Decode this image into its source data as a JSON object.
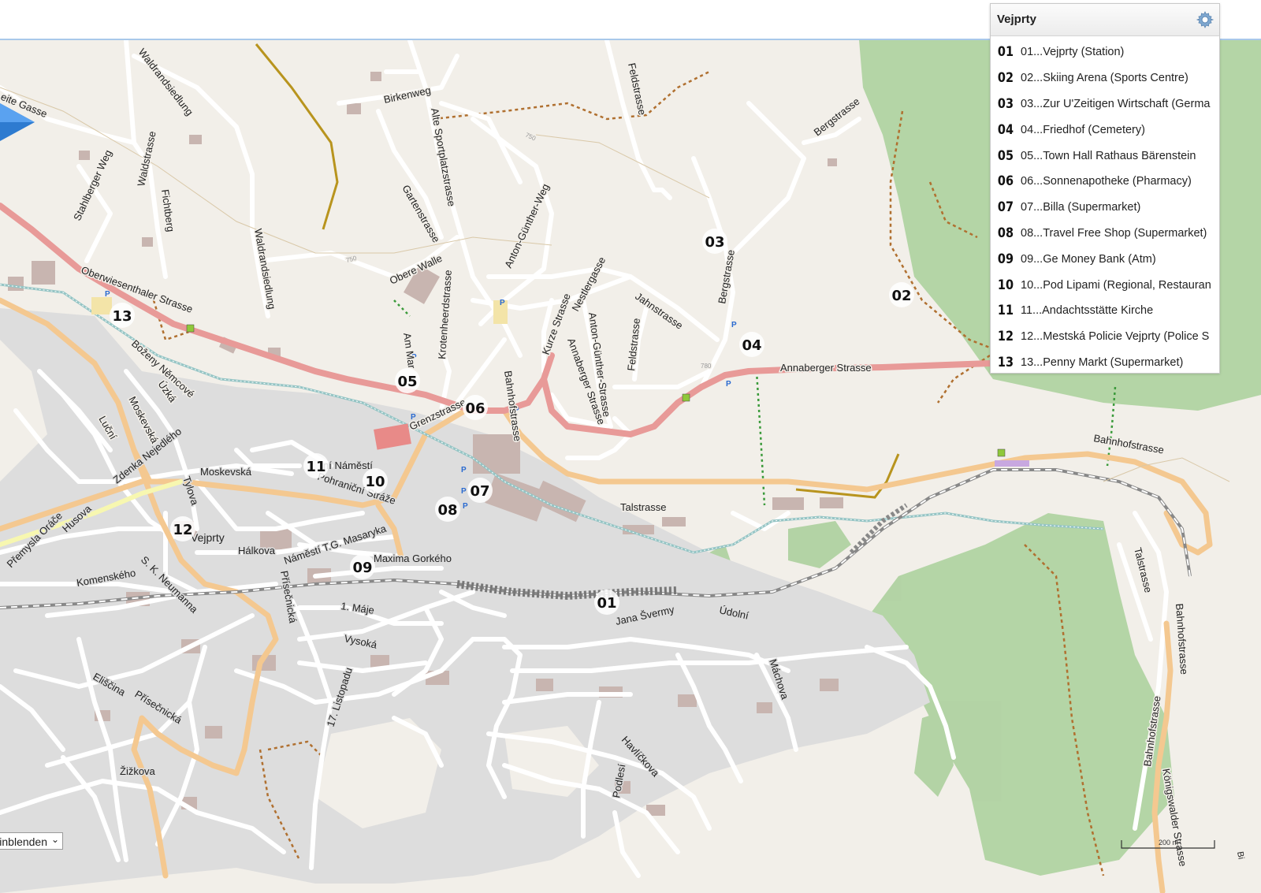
{
  "map": {
    "panel": {
      "title": "Vejprty",
      "icon": "gear-icon",
      "items": [
        {
          "num": "01",
          "label": "01...Vejprty (Station)"
        },
        {
          "num": "02",
          "label": "02...Skiing Arena (Sports Centre)"
        },
        {
          "num": "03",
          "label": "03...Zur U'Zeitigen Wirtschaft (Germa"
        },
        {
          "num": "04",
          "label": "04...Friedhof (Cemetery)"
        },
        {
          "num": "05",
          "label": "05...Town Hall Rathaus Bärenstein"
        },
        {
          "num": "06",
          "label": "06...Sonnenapotheke (Pharmacy)"
        },
        {
          "num": "07",
          "label": "07...Billa (Supermarket)"
        },
        {
          "num": "08",
          "label": "08...Travel Free Shop (Supermarket)"
        },
        {
          "num": "09",
          "label": "09...Ge Money Bank (Atm)"
        },
        {
          "num": "10",
          "label": "10...Pod Lipami (Regional, Restauran"
        },
        {
          "num": "11",
          "label": "11...Andachtsstätte Kirche"
        },
        {
          "num": "12",
          "label": "12...Mestská Policie Vejprty (Police S"
        },
        {
          "num": "13",
          "label": "13...Penny Markt (Supermarket)"
        }
      ]
    },
    "markers": [
      "01",
      "02",
      "03",
      "04",
      "05",
      "06",
      "07",
      "08",
      "09",
      "10",
      "11",
      "12",
      "13"
    ],
    "streets": {
      "weite_gasse": "eite Gasse",
      "waldrandsiedlung": "Waldrandsiedlung",
      "birkenweg": "Birkenweg",
      "alte_sportplatzstrasse": "Alte Sportplatzstrasse",
      "feldstrasse": "Feldstrasse",
      "bergstrasse": "Bergstrasse",
      "stahlberger_weg": "Stahlberger Weg",
      "waldstrasse": "Waldstrasse",
      "fichtberg": "Fichtberg",
      "gartenstrasse": "Gartenstrasse",
      "anton_gunther_weg": "Anton-Günther-Weg",
      "waldrandsiedlung2": "Waldrandsiedlung",
      "obere_walle": "Obere Walle",
      "krotenheerdstrasse": "Krotenheerdstrasse",
      "oberwiesenthaler": "Oberwiesenthaler Strasse",
      "nestlergasse": "Nestlergasse",
      "kurze_strasse": "Kurze Strasse",
      "jahnstrasse": "Jahnstrasse",
      "bergstrasse2": "Bergstrasse",
      "anton_gunther_strasse": "Anton-Günther-Strasse",
      "feldstrasse2": "Feldstrasse",
      "am_markt": "Am Mar",
      "annaberger": "Annaberger Strasse",
      "bahnhofstrasse": "Bahnhofstrasse",
      "annaberger_strasse2": "Annaberger Strasse",
      "bozeny": "Boženy Němcové",
      "uzka": "Úzká",
      "moskevska_v": "Moskevská",
      "lucni": "Luční",
      "grenzstrasse": "Grenzstrasse",
      "zdenka": "Zdenka Nejedlého",
      "moskevska": "Moskevská",
      "namesti": "ní Náměstí",
      "pohranicni": "Pohraniční Stráže",
      "bahnhofstrasse2": "Bahnhofstrasse",
      "tylova": "Tylova",
      "premysla": "Přemysla Oráče",
      "husova": "Husova",
      "talstrasse": "Talstrasse",
      "vejprty": "Vejprty",
      "halkova": "Hálkova",
      "namesti_tg": "Náměstí T.G. Masaryka",
      "maxima": "Maxima Gorkého",
      "komenskeho": "Komenského",
      "neumanna": "S. K. Neumanna",
      "prisecnicka": "Přísečnická",
      "talstrasse2": "Talstrasse",
      "jana_sverme": "Jana Švermy",
      "udolni": "Údolní",
      "bahnhofstrasse3": "Bahnhofstrasse",
      "prvni_maje": "1. Máje",
      "vysoka": "Vysoká",
      "machova": "Máchova",
      "eliscina": "Eliščina",
      "prisecnicka2": "Přísečnická",
      "listopadu": "17. Listopadu",
      "havlickova": "Havlíčkova",
      "bahnhofstrasse4": "Bahnhofstrasse",
      "konigswalder": "Königswalder Strasse",
      "pod_lesi": "Podlesí",
      "zizkova": "Žižkova",
      "contour_750": "750",
      "contour_780": "780",
      "contour_750b": "750"
    },
    "layer_select": {
      "value": "Einblenden"
    },
    "scale": "200 m",
    "edge_label": "Bi"
  }
}
